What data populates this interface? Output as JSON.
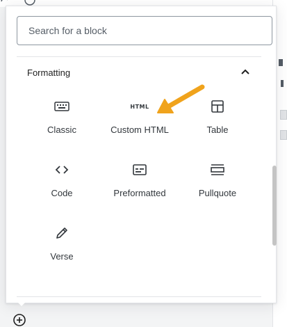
{
  "search": {
    "placeholder": "Search for a block",
    "value": ""
  },
  "panel": {
    "title": "Formatting",
    "expanded": true
  },
  "blocks": [
    {
      "label": "Classic",
      "icon": "keyboard-icon"
    },
    {
      "label": "Custom HTML",
      "icon": "html-icon",
      "badge": "HTML"
    },
    {
      "label": "Table",
      "icon": "table-icon"
    },
    {
      "label": "Code",
      "icon": "code-icon"
    },
    {
      "label": "Preformatted",
      "icon": "preformatted-icon"
    },
    {
      "label": "Pullquote",
      "icon": "pullquote-icon"
    },
    {
      "label": "Verse",
      "icon": "pencil-icon"
    }
  ],
  "colors": {
    "accent": "#f0a31c",
    "text": "#32373c",
    "border": "#8d96a0"
  }
}
